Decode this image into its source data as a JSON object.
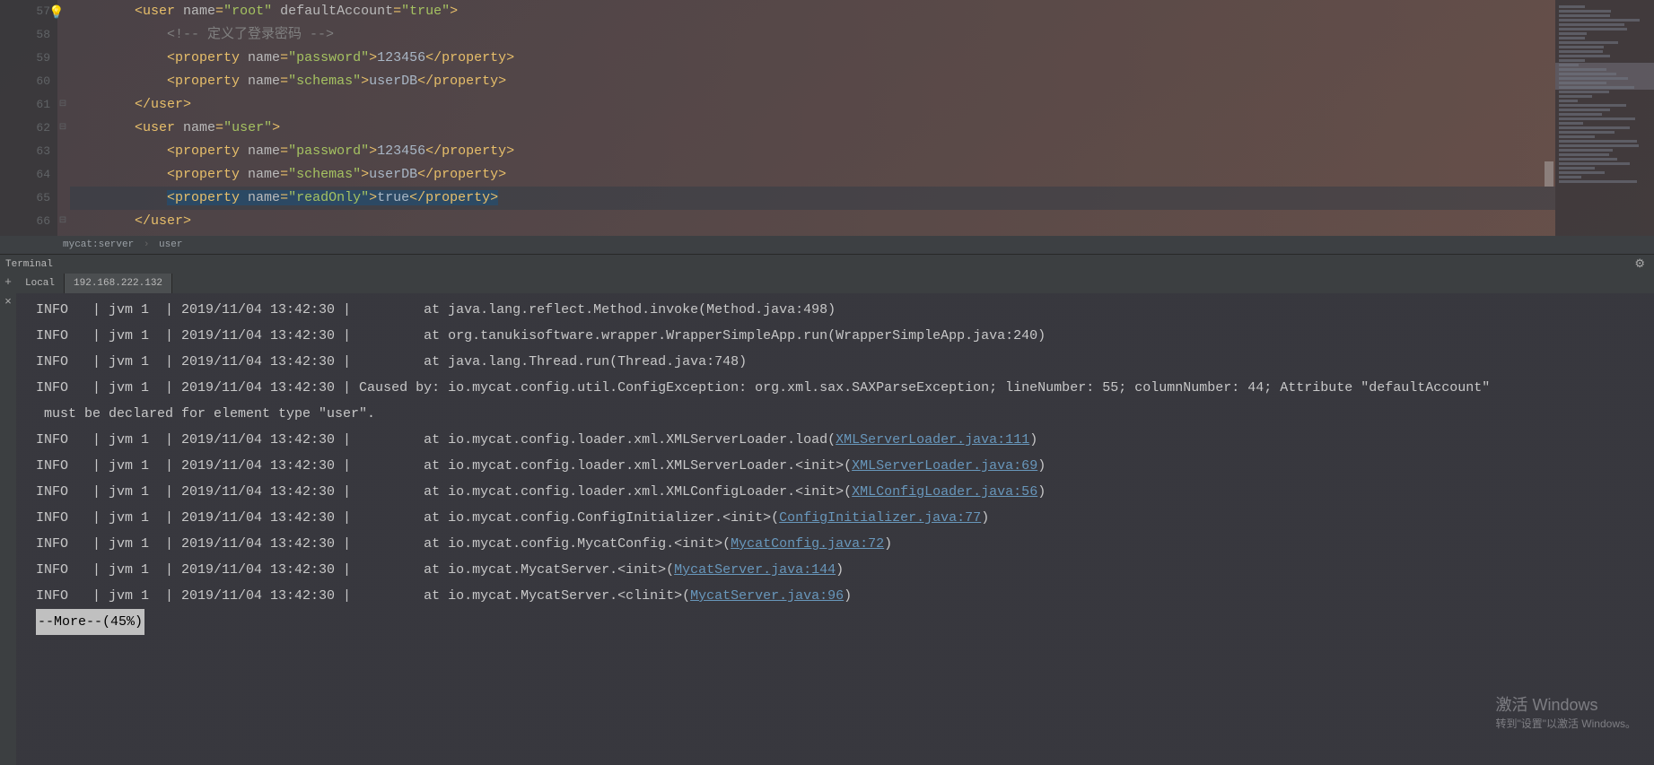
{
  "editor": {
    "gutter_start": 57,
    "lines": [
      {
        "num": "57",
        "indent": 2,
        "fold": "",
        "raw": [
          {
            "c": "t-tag",
            "t": "<user "
          },
          {
            "c": "t-attr",
            "t": "name"
          },
          {
            "c": "t-tag",
            "t": "="
          },
          {
            "c": "t-val",
            "t": "\"root\" "
          },
          {
            "c": "t-attr",
            "t": "defaultAccount"
          },
          {
            "c": "t-tag",
            "t": "="
          },
          {
            "c": "t-val",
            "t": "\"true\""
          },
          {
            "c": "t-tag",
            "t": ">"
          }
        ]
      },
      {
        "num": "58",
        "indent": 3,
        "fold": "",
        "raw": [
          {
            "c": "t-comment",
            "t": "<!-- 定义了登录密码 -->"
          }
        ]
      },
      {
        "num": "59",
        "indent": 3,
        "fold": "",
        "raw": [
          {
            "c": "t-tag",
            "t": "<property "
          },
          {
            "c": "t-attr",
            "t": "name"
          },
          {
            "c": "t-tag",
            "t": "="
          },
          {
            "c": "t-val",
            "t": "\"password\""
          },
          {
            "c": "t-tag",
            "t": ">"
          },
          {
            "c": "t-text",
            "t": "123456"
          },
          {
            "c": "t-tag",
            "t": "</property>"
          }
        ]
      },
      {
        "num": "60",
        "indent": 3,
        "fold": "",
        "raw": [
          {
            "c": "t-tag",
            "t": "<property "
          },
          {
            "c": "t-attr",
            "t": "name"
          },
          {
            "c": "t-tag",
            "t": "="
          },
          {
            "c": "t-val",
            "t": "\"schemas\""
          },
          {
            "c": "t-tag",
            "t": ">"
          },
          {
            "c": "t-text",
            "t": "userDB"
          },
          {
            "c": "t-tag",
            "t": "</property>"
          }
        ]
      },
      {
        "num": "61",
        "indent": 2,
        "fold": "-",
        "raw": [
          {
            "c": "t-tag",
            "t": "</user>"
          }
        ]
      },
      {
        "num": "62",
        "indent": 2,
        "fold": "-",
        "raw": [
          {
            "c": "t-tag",
            "t": "<user "
          },
          {
            "c": "t-attr",
            "t": "name"
          },
          {
            "c": "t-tag",
            "t": "="
          },
          {
            "c": "t-val",
            "t": "\"user\""
          },
          {
            "c": "t-tag",
            "t": ">"
          }
        ]
      },
      {
        "num": "63",
        "indent": 3,
        "fold": "",
        "raw": [
          {
            "c": "t-tag",
            "t": "<property "
          },
          {
            "c": "t-attr",
            "t": "name"
          },
          {
            "c": "t-tag",
            "t": "="
          },
          {
            "c": "t-val",
            "t": "\"password\""
          },
          {
            "c": "t-tag",
            "t": ">"
          },
          {
            "c": "t-text",
            "t": "123456"
          },
          {
            "c": "t-tag",
            "t": "</property>"
          }
        ]
      },
      {
        "num": "64",
        "indent": 3,
        "fold": "",
        "raw": [
          {
            "c": "t-tag",
            "t": "<property "
          },
          {
            "c": "t-attr",
            "t": "name"
          },
          {
            "c": "t-tag",
            "t": "="
          },
          {
            "c": "t-val",
            "t": "\"schemas\""
          },
          {
            "c": "t-tag",
            "t": ">"
          },
          {
            "c": "t-text",
            "t": "userDB"
          },
          {
            "c": "t-tag",
            "t": "</property>"
          }
        ]
      },
      {
        "num": "65",
        "indent": 3,
        "fold": "",
        "hl": true,
        "bulb": true,
        "sel": true,
        "raw": [
          {
            "c": "t-tag",
            "t": "<property "
          },
          {
            "c": "t-attr",
            "t": "name"
          },
          {
            "c": "t-tag",
            "t": "="
          },
          {
            "c": "t-val",
            "t": "\"readOnly\""
          },
          {
            "c": "t-tag",
            "t": ">"
          },
          {
            "c": "t-text",
            "t": "true"
          },
          {
            "c": "t-tag",
            "t": "</property>"
          }
        ]
      },
      {
        "num": "66",
        "indent": 2,
        "fold": "-",
        "raw": [
          {
            "c": "t-tag",
            "t": "</user>"
          }
        ]
      }
    ],
    "breadcrumb": [
      "mycat:server",
      "user"
    ]
  },
  "terminal": {
    "title": "Terminal",
    "tabs": [
      {
        "label": "Local",
        "active": false
      },
      {
        "label": "192.168.222.132",
        "active": true
      }
    ],
    "side_icons": {
      "add": "+",
      "close": "×"
    },
    "gear_icon": "⚙",
    "logs": [
      {
        "level": "INFO",
        "jvm": "jvm 1",
        "ts": "2019/11/04 13:42:30",
        "msg": "        at java.lang.reflect.Method.invoke(Method.java:498)"
      },
      {
        "level": "INFO",
        "jvm": "jvm 1",
        "ts": "2019/11/04 13:42:30",
        "msg": "        at org.tanukisoftware.wrapper.WrapperSimpleApp.run(WrapperSimpleApp.java:240)"
      },
      {
        "level": "INFO",
        "jvm": "jvm 1",
        "ts": "2019/11/04 13:42:30",
        "msg": "        at java.lang.Thread.run(Thread.java:748)"
      },
      {
        "level": "INFO",
        "jvm": "jvm 1",
        "ts": "2019/11/04 13:42:30",
        "msg": "Caused by: io.mycat.config.util.ConfigException: org.xml.sax.SAXParseException; lineNumber: 55; columnNumber: 44; Attribute \"defaultAccount\"",
        "cont": " must be declared for element type \"user\"."
      },
      {
        "level": "INFO",
        "jvm": "jvm 1",
        "ts": "2019/11/04 13:42:30",
        "msg": "        at io.mycat.config.loader.xml.XMLServerLoader.load(",
        "link": "XMLServerLoader.java:111",
        "tail": ")"
      },
      {
        "level": "INFO",
        "jvm": "jvm 1",
        "ts": "2019/11/04 13:42:30",
        "msg": "        at io.mycat.config.loader.xml.XMLServerLoader.<init>(",
        "link": "XMLServerLoader.java:69",
        "tail": ")"
      },
      {
        "level": "INFO",
        "jvm": "jvm 1",
        "ts": "2019/11/04 13:42:30",
        "msg": "        at io.mycat.config.loader.xml.XMLConfigLoader.<init>(",
        "link": "XMLConfigLoader.java:56",
        "tail": ")"
      },
      {
        "level": "INFO",
        "jvm": "jvm 1",
        "ts": "2019/11/04 13:42:30",
        "msg": "        at io.mycat.config.ConfigInitializer.<init>(",
        "link": "ConfigInitializer.java:77",
        "tail": ")"
      },
      {
        "level": "INFO",
        "jvm": "jvm 1",
        "ts": "2019/11/04 13:42:30",
        "msg": "        at io.mycat.config.MycatConfig.<init>(",
        "link": "MycatConfig.java:72",
        "tail": ")"
      },
      {
        "level": "INFO",
        "jvm": "jvm 1",
        "ts": "2019/11/04 13:42:30",
        "msg": "        at io.mycat.MycatServer.<init>(",
        "link": "MycatServer.java:144",
        "tail": ")"
      },
      {
        "level": "INFO",
        "jvm": "jvm 1",
        "ts": "2019/11/04 13:42:30",
        "msg": "        at io.mycat.MycatServer.<clinit>(",
        "link": "MycatServer.java:96",
        "tail": ")"
      }
    ],
    "more": "--More--(45%)"
  },
  "watermark": {
    "line1": "激活 Windows",
    "line2": "转到\"设置\"以激活 Windows。"
  }
}
